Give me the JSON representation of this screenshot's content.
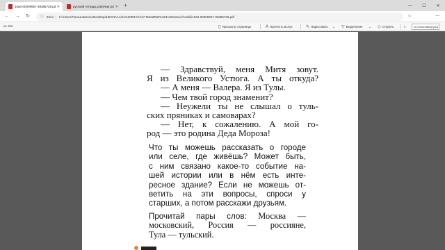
{
  "browser": {
    "tabs": [
      {
        "title": "10a0-00009957-39385726.pdf",
        "active": true
      },
      {
        "title": "русский тетрадь рабочая.pdf",
        "active": false
      }
    ],
    "new_tab": "+",
    "window": {
      "minimize": "—",
      "maximize": "☐",
      "close": "✕"
    },
    "address": {
      "info_icon": "ⓘ",
      "label": "Файл",
      "separator": "|",
      "url": "C:/Users/Пользователь/Desktop/ШКОЛААА/11%20КЛАСС/УЧЕБНИКИ%201%20класс/russkiii10a0-00009957-39385726.pdf"
    }
  },
  "pdf_toolbar": {
    "page_count": "из 182",
    "items": [
      {
        "icon": "page-view-icon",
        "label": "Просмотр страницы"
      },
      {
        "icon": "read-aloud-icon",
        "label": "Прочесть вслух"
      },
      {
        "icon": "draw-icon",
        "label": "Нарисовать"
      },
      {
        "icon": "highlight-icon",
        "label": "Выделение"
      },
      {
        "icon": "erase-icon",
        "label": "Стереть"
      }
    ],
    "search_value": "на синонимы/русск"
  },
  "document": {
    "dialog_lines": [
      "— Здравствуй, меня Митя зовут.",
      "Я из Великого Устюга. А ты откуда?",
      "— А меня — Валера. Я из Тулы.",
      "— Чем твой город знаменит?",
      "— Неужели ты не слышал о туль-",
      "ских пряниках и самоварах?",
      "— Нет, к сожалению. А мой го-",
      "род — это родина Деда Мороза!"
    ],
    "task1_lines": [
      "Что ты можешь рассказать о городе",
      "или селе, где живёшь? Может быть,",
      "с ним связано какое-то событие на-",
      "шей истории или в нём есть инте-",
      "ресное здание? Если не можешь от-",
      "ветить на эти вопросы, спроси у",
      "старших, а потом расскажи друзьям."
    ],
    "task2": {
      "line1_prefix": "Прочитай пары слов: ",
      "line1_example": "Москва —",
      "line2": "московский, Россия — россияне,",
      "line3": "Тула — тульский."
    }
  }
}
